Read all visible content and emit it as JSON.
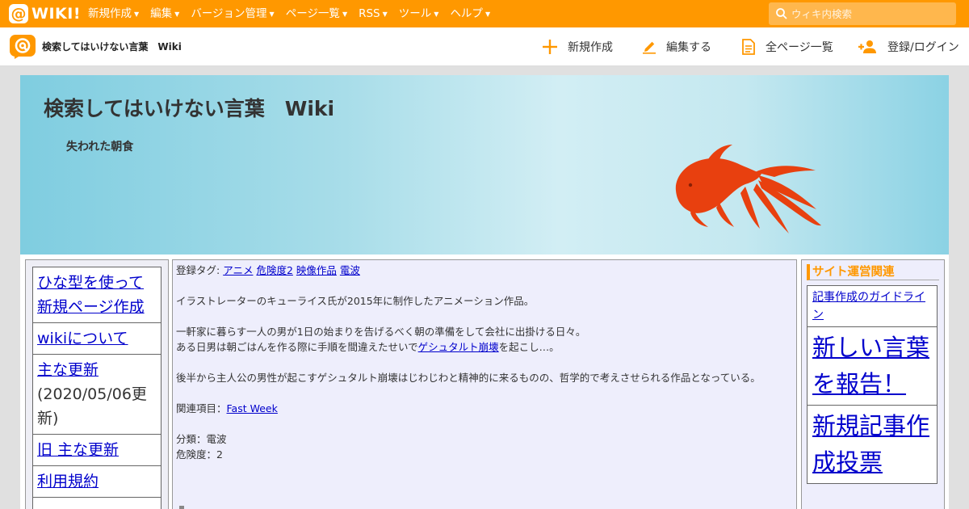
{
  "topbar": {
    "logo_text": "WIKI!",
    "nav": [
      {
        "label": "新規作成"
      },
      {
        "label": "編集"
      },
      {
        "label": "バージョン管理"
      },
      {
        "label": "ページ一覧"
      },
      {
        "label": "RSS"
      },
      {
        "label": "ツール"
      },
      {
        "label": "ヘルプ"
      }
    ],
    "search_placeholder": "ウィキ内検索"
  },
  "subbar": {
    "site_name": "検索してはいけない言葉　Wiki",
    "actions": {
      "new": "新規作成",
      "edit": "編集する",
      "all_pages": "全ページ一覧",
      "login": "登録/ログイン"
    }
  },
  "banner": {
    "title": "検索してはいけない言葉　Wiki",
    "subtitle": "失われた朝食"
  },
  "left_menu": {
    "items": [
      {
        "label": "ひな型を使って新規ページ作成"
      },
      {
        "label": "wikiについて"
      },
      {
        "label": "主な更新",
        "note": "(2020/05/06更新)"
      },
      {
        "label": "旧 主な更新"
      },
      {
        "label": "利用規約"
      }
    ]
  },
  "article": {
    "tags_prefix": "登録タグ:",
    "tags": [
      "アニメ",
      "危険度2",
      "映像作品",
      "電波"
    ],
    "para1": "イラストレーターのキューライス氏が2015年に制作したアニメーション作品。",
    "para2_line1": "一軒家に暮らす一人の男が1日の始まりを告げるべく朝の準備をして会社に出掛ける日々。",
    "para2_line2_before": "ある日男は朝ごはんを作る際に手順を間違えたせいで",
    "para2_link": "ゲシュタルト崩壊",
    "para2_line2_after": "を起こし…。",
    "para3": "後半から主人公の男性が起こすゲシュタルト崩壊はじわじわと精神的に来るものの、哲学的で考えさせられる作品となっている。",
    "related_label": "関連項目：",
    "related_link": "Fast Week",
    "category": "分類：電波",
    "danger": "危険度：2"
  },
  "right_menu": {
    "heading": "サイト運営関連",
    "items": [
      {
        "label": "記事作成のガイドライン"
      },
      {
        "label": "新しい言葉を報告！"
      },
      {
        "label": "新規記事作成投票"
      }
    ]
  },
  "colors": {
    "brand": "#ff9800",
    "link": "#0000cc",
    "fish": "#e8400f"
  }
}
